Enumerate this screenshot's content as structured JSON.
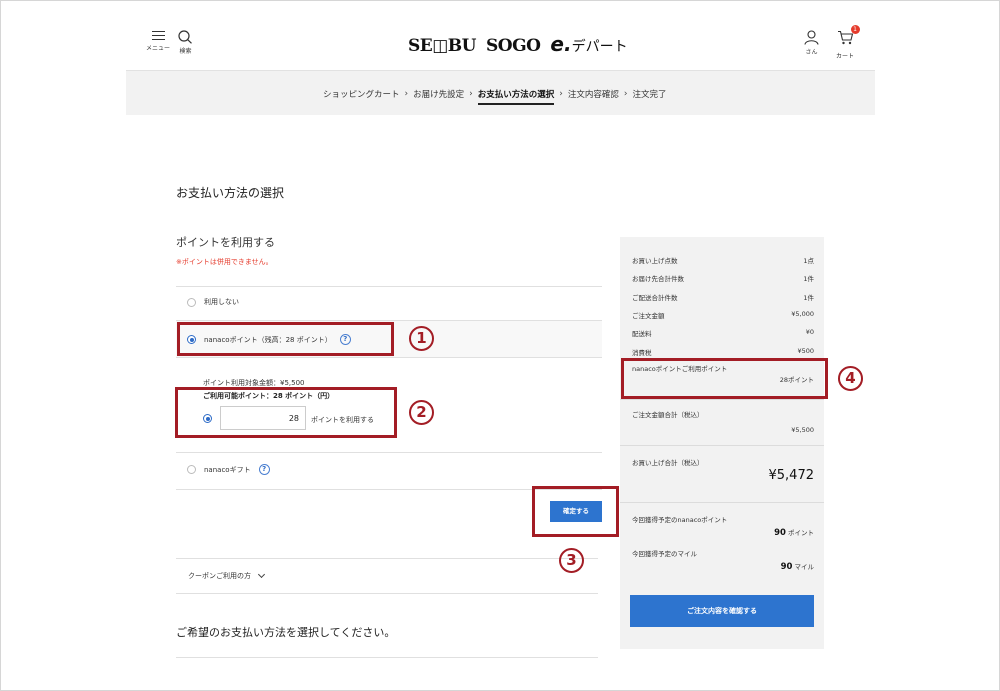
{
  "header": {
    "menu_label": "メニュー",
    "search_label": "検索",
    "user_label": "さん",
    "cart_label": "カート",
    "cart_count": "1",
    "logo": {
      "seibu": "SE◫BU",
      "sogo": "SOGO",
      "e": "e.",
      "dept": "デパート"
    }
  },
  "breadcrumb": {
    "steps": [
      "ショッピングカート",
      "お届け先設定",
      "お支払い方法の選択",
      "注文内容確認",
      "注文完了"
    ],
    "active_index": 2
  },
  "main": {
    "page_title": "お支払い方法の選択",
    "points_title": "ポイントを利用する",
    "points_note": "※ポイントは併用できません。",
    "option_none": "利用しない",
    "option_nanaco": "nanacoポイント（残高：28 ポイント）",
    "target_amount": "ポイント利用対象金額：¥5,500",
    "available_points": "ご利用可能ポイント：28 ポイント（円）",
    "points_input_value": "28",
    "points_input_suffix": "ポイントを利用する",
    "option_gift": "nanacoギフト",
    "help_symbol": "?",
    "confirm_button": "確定する",
    "coupon_label": "クーポンご利用の方",
    "bottom_message": "ご希望のお支払い方法を選択してください。"
  },
  "annotations": [
    "1",
    "2",
    "3",
    "4"
  ],
  "summary": {
    "rows": [
      {
        "label": "お買い上げ点数",
        "value": "1点"
      },
      {
        "label": "お届け先合計件数",
        "value": "1件"
      },
      {
        "label": "ご配送合計件数",
        "value": "1件"
      },
      {
        "label": "ご注文金額",
        "value": "¥5,000"
      },
      {
        "label": "配送料",
        "value": "¥0"
      },
      {
        "label": "消費税",
        "value": "¥500"
      }
    ],
    "nanaco_points_label": "nanacoポイントご利用ポイント",
    "nanaco_points_value": "28ポイント",
    "order_total_label": "ご注文金額合計（税込）",
    "order_total_value": "¥5,500",
    "purchase_total_label": "お買い上げ合計（税込）",
    "purchase_total_value": "¥5,472",
    "earn_nanaco_label": "今回獲得予定のnanacoポイント",
    "earn_nanaco_value": "90",
    "earn_nanaco_unit": "ポイント",
    "earn_mile_label": "今回獲得予定のマイル",
    "earn_mile_value": "90",
    "earn_mile_unit": "マイル",
    "checkout_button": "ご注文内容を確認する"
  },
  "colors": {
    "accent_blue": "#2d74cf",
    "annotation_red": "#a31d25",
    "note_red": "#e53b2c"
  }
}
